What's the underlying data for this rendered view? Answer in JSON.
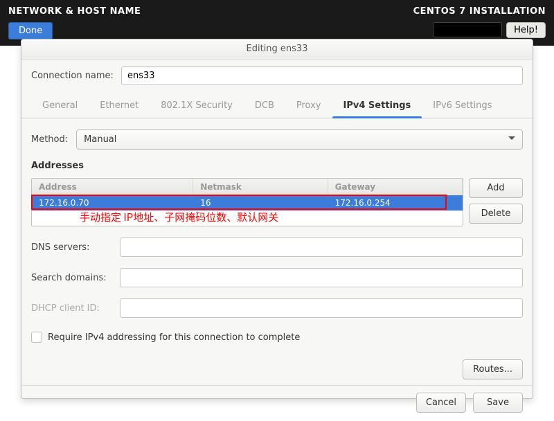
{
  "topbar": {
    "left": "NETWORK & HOST NAME",
    "right": "CENTOS 7 INSTALLATION",
    "done": "Done",
    "help": "Help!"
  },
  "dialog": {
    "title": "Editing ens33",
    "conn_label": "Connection name:",
    "conn_value": "ens33",
    "tabs": [
      "General",
      "Ethernet",
      "802.1X Security",
      "DCB",
      "Proxy",
      "IPv4 Settings",
      "IPv6 Settings"
    ],
    "active_tab": "IPv4 Settings",
    "method_label": "Method:",
    "method_value": "Manual",
    "addresses_title": "Addresses",
    "addr_headers": {
      "address": "Address",
      "netmask": "Netmask",
      "gateway": "Gateway"
    },
    "addr_row": {
      "address": "172.16.0.70",
      "netmask": "16",
      "gateway": "172.16.0.254"
    },
    "annotation_text": "手动指定 IP地址、子网掩码位数、默认网关",
    "side": {
      "add": "Add",
      "delete": "Delete"
    },
    "dns_label": "DNS servers:",
    "search_label": "Search domains:",
    "dhcp_label": "DHCP client ID:",
    "require_label": "Require IPv4 addressing for this connection to complete",
    "routes": "Routes...",
    "cancel": "Cancel",
    "save": "Save"
  }
}
